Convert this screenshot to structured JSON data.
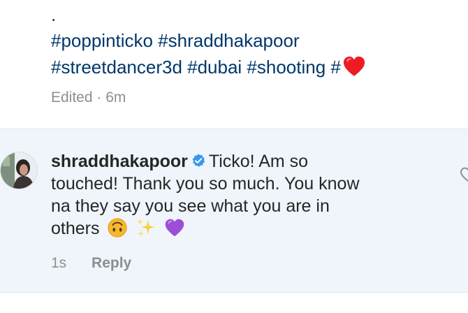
{
  "caption": {
    "dot": ".",
    "hashtag_line_1": "#poppinticko #shraddhakapoor",
    "hashtag_line_2": "#streetdancer3d #dubai #shooting #",
    "heart_icon": "red-heart-icon",
    "edited_label": "Edited",
    "separator": "·",
    "time": "6m"
  },
  "comment": {
    "username": "shraddhakapoor",
    "verified_icon": "verified-badge-icon",
    "text_line_1": "Ticko! Am so",
    "text_line_2": "touched! Thank you so much. You know",
    "text_line_3": "na they say you see what you are in",
    "text_line_4": "others",
    "emojis": [
      "upside-down-face-icon",
      "sparkles-icon",
      "purple-heart-icon"
    ],
    "time": "1s",
    "reply_label": "Reply"
  },
  "colors": {
    "hashtag": "#00376b",
    "text": "#262626",
    "muted": "#8e8e8e",
    "highlight_background": "#eff5fb",
    "verified": "#3897f0",
    "heart": "#ed1c24",
    "purple_heart": "#9b4fd9"
  }
}
